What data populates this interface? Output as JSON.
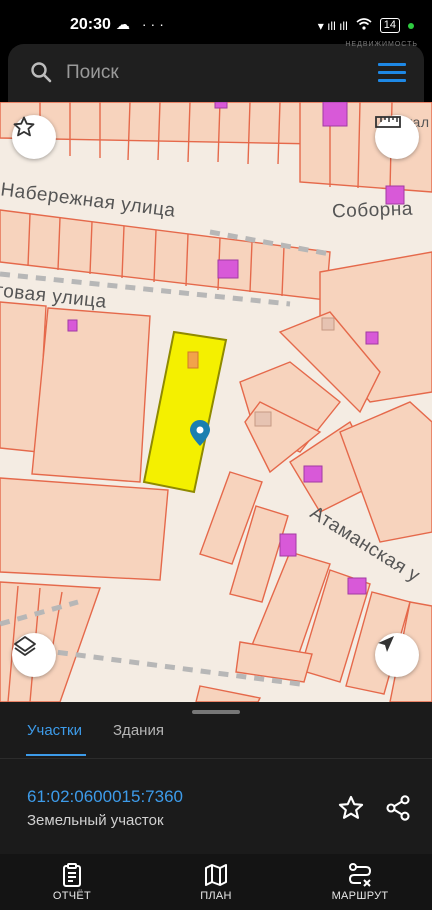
{
  "status_bar": {
    "time": "20:30",
    "left_icons": "☁ ···",
    "signal": "▾ ıll ıll",
    "battery": "14"
  },
  "search": {
    "placeholder": "Поиск",
    "watermark": "НЕДВИЖИМОСТЬ"
  },
  "map": {
    "streets": [
      "Набережная улица",
      "Соборна",
      "говая улица",
      "Атаманская у",
      "астал"
    ],
    "colors": {
      "parcel_fill": "#f7d3bd",
      "parcel_stroke": "#e5694b",
      "selected_fill": "#f4f000",
      "selected_stroke": "#8f8a00",
      "building": "#d859d8",
      "marker": "#1a7fb0"
    }
  },
  "panel": {
    "tabs": [
      "Участки",
      "Здания"
    ],
    "active_tab": "Участки",
    "cadastral_number": "61:02:0600015:7360",
    "property_type": "Земельный участок"
  },
  "bottom_nav": [
    {
      "label": "ОТЧЁТ",
      "icon": "report-icon"
    },
    {
      "label": "ПЛАН",
      "icon": "map-plan-icon"
    },
    {
      "label": "МАРШРУТ",
      "icon": "route-icon"
    }
  ]
}
